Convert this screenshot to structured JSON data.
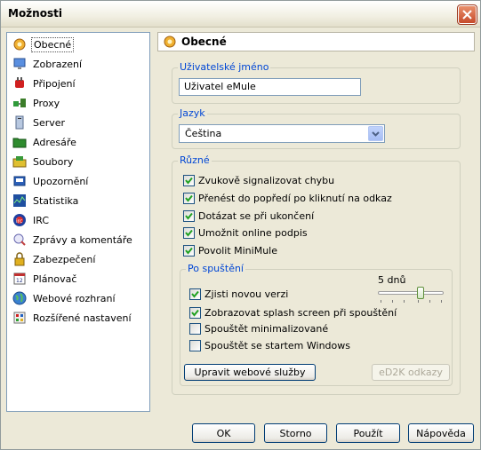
{
  "window": {
    "title": "Možnosti"
  },
  "sidebar": {
    "items": [
      {
        "label": "Obecné",
        "icon": "gear-icon",
        "selected": true
      },
      {
        "label": "Zobrazení",
        "icon": "monitor-icon"
      },
      {
        "label": "Připojení",
        "icon": "plug-icon"
      },
      {
        "label": "Proxy",
        "icon": "proxy-icon"
      },
      {
        "label": "Server",
        "icon": "server-icon"
      },
      {
        "label": "Adresáře",
        "icon": "folder-icon"
      },
      {
        "label": "Soubory",
        "icon": "files-icon"
      },
      {
        "label": "Upozornění",
        "icon": "notification-icon"
      },
      {
        "label": "Statistika",
        "icon": "statistics-icon"
      },
      {
        "label": "IRC",
        "icon": "irc-icon"
      },
      {
        "label": "Zprávy a komentáře",
        "icon": "messages-icon"
      },
      {
        "label": "Zabezpečení",
        "icon": "lock-icon"
      },
      {
        "label": "Plánovač",
        "icon": "calendar-icon"
      },
      {
        "label": "Webové rozhraní",
        "icon": "globe-icon"
      },
      {
        "label": "Rozšířené nastavení",
        "icon": "advanced-settings-icon"
      }
    ]
  },
  "panel": {
    "title": "Obecné",
    "username": {
      "legend": "Uživatelské jméno",
      "value": "Uživatel eMule"
    },
    "language": {
      "legend": "Jazyk",
      "selected": "Čeština"
    },
    "misc": {
      "legend": "Různé",
      "checks": [
        {
          "label": "Zvukově signalizovat chybu",
          "checked": true
        },
        {
          "label": "Přenést do popředí po kliknutí na odkaz",
          "checked": true
        },
        {
          "label": "Dotázat se při ukončení",
          "checked": true
        },
        {
          "label": "Umožnit online podpis",
          "checked": true
        },
        {
          "label": "Povolit MiniMule",
          "checked": true
        }
      ]
    },
    "startup": {
      "legend": "Po spuštění",
      "interval_label": "5 dnů",
      "interval_level": 0.67,
      "checks": [
        {
          "label": "Zjisti novou verzi",
          "checked": true
        },
        {
          "label": "Zobrazovat splash screen při spouštění",
          "checked": true
        },
        {
          "label": "Spouštět minimalizované",
          "checked": false
        },
        {
          "label": "Spouštět se startem Windows",
          "checked": false
        }
      ]
    },
    "buttons": {
      "web_services": "Upravit webové služby",
      "ed2k_links": "eD2K odkazy"
    }
  },
  "footer": {
    "ok": "OK",
    "cancel": "Storno",
    "apply": "Použít",
    "help": "Nápověda"
  }
}
